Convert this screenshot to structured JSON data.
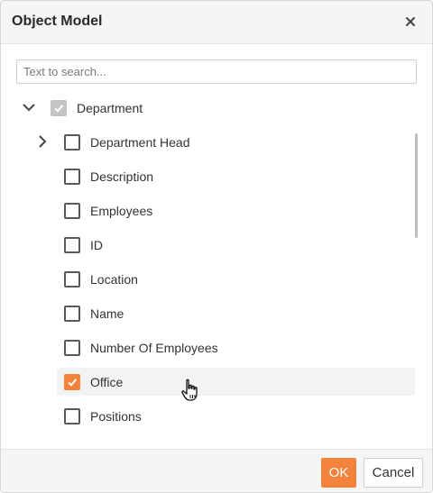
{
  "dialog": {
    "title": "Object Model",
    "close_icon": "close-icon"
  },
  "search": {
    "placeholder": "Text to search...",
    "value": ""
  },
  "tree": {
    "root": {
      "label": "Department",
      "expanded": true,
      "checked": "partial"
    },
    "children": [
      {
        "label": "Department Head",
        "has_children": true,
        "checked": false
      },
      {
        "label": "Description",
        "has_children": false,
        "checked": false
      },
      {
        "label": "Employees",
        "has_children": false,
        "checked": false
      },
      {
        "label": "ID",
        "has_children": false,
        "checked": false
      },
      {
        "label": "Location",
        "has_children": false,
        "checked": false
      },
      {
        "label": "Name",
        "has_children": false,
        "checked": false
      },
      {
        "label": "Number Of Employees",
        "has_children": false,
        "checked": false
      },
      {
        "label": "Office",
        "has_children": false,
        "checked": true
      },
      {
        "label": "Positions",
        "has_children": false,
        "checked": false
      }
    ]
  },
  "footer": {
    "ok_label": "OK",
    "cancel_label": "Cancel"
  },
  "colors": {
    "accent": "#f3823d",
    "header_bg": "#f5f5f5",
    "partial_check": "#c4c4c4"
  }
}
